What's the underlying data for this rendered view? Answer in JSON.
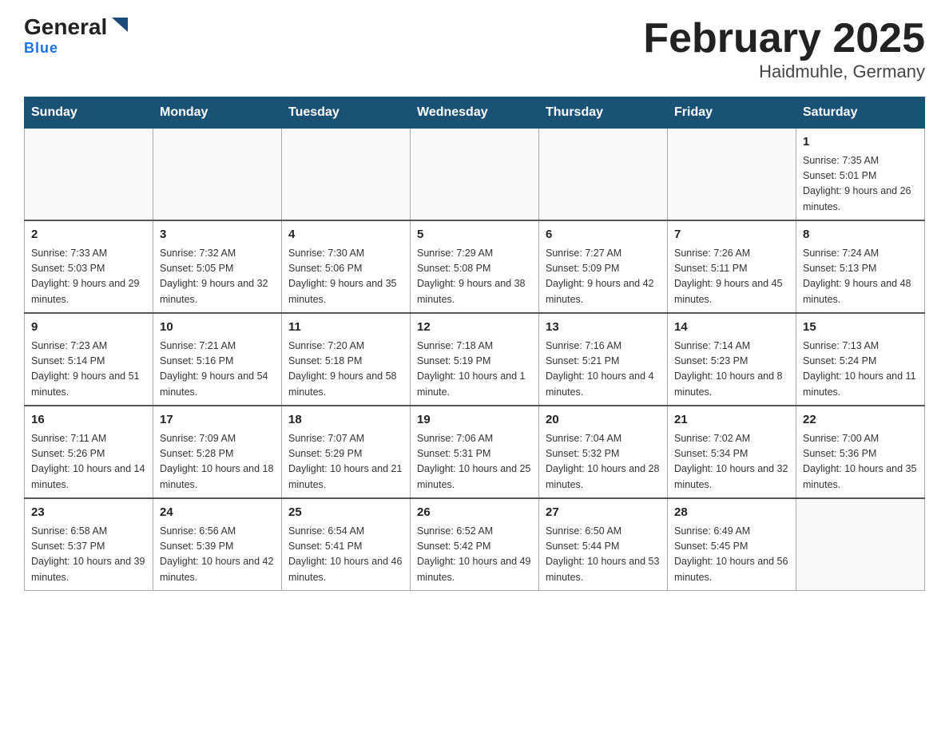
{
  "header": {
    "logo_main": "General",
    "logo_blue": "Blue",
    "title": "February 2025",
    "subtitle": "Haidmuhle, Germany"
  },
  "weekdays": [
    "Sunday",
    "Monday",
    "Tuesday",
    "Wednesday",
    "Thursday",
    "Friday",
    "Saturday"
  ],
  "weeks": [
    [
      {
        "day": "",
        "info": ""
      },
      {
        "day": "",
        "info": ""
      },
      {
        "day": "",
        "info": ""
      },
      {
        "day": "",
        "info": ""
      },
      {
        "day": "",
        "info": ""
      },
      {
        "day": "",
        "info": ""
      },
      {
        "day": "1",
        "info": "Sunrise: 7:35 AM\nSunset: 5:01 PM\nDaylight: 9 hours and 26 minutes."
      }
    ],
    [
      {
        "day": "2",
        "info": "Sunrise: 7:33 AM\nSunset: 5:03 PM\nDaylight: 9 hours and 29 minutes."
      },
      {
        "day": "3",
        "info": "Sunrise: 7:32 AM\nSunset: 5:05 PM\nDaylight: 9 hours and 32 minutes."
      },
      {
        "day": "4",
        "info": "Sunrise: 7:30 AM\nSunset: 5:06 PM\nDaylight: 9 hours and 35 minutes."
      },
      {
        "day": "5",
        "info": "Sunrise: 7:29 AM\nSunset: 5:08 PM\nDaylight: 9 hours and 38 minutes."
      },
      {
        "day": "6",
        "info": "Sunrise: 7:27 AM\nSunset: 5:09 PM\nDaylight: 9 hours and 42 minutes."
      },
      {
        "day": "7",
        "info": "Sunrise: 7:26 AM\nSunset: 5:11 PM\nDaylight: 9 hours and 45 minutes."
      },
      {
        "day": "8",
        "info": "Sunrise: 7:24 AM\nSunset: 5:13 PM\nDaylight: 9 hours and 48 minutes."
      }
    ],
    [
      {
        "day": "9",
        "info": "Sunrise: 7:23 AM\nSunset: 5:14 PM\nDaylight: 9 hours and 51 minutes."
      },
      {
        "day": "10",
        "info": "Sunrise: 7:21 AM\nSunset: 5:16 PM\nDaylight: 9 hours and 54 minutes."
      },
      {
        "day": "11",
        "info": "Sunrise: 7:20 AM\nSunset: 5:18 PM\nDaylight: 9 hours and 58 minutes."
      },
      {
        "day": "12",
        "info": "Sunrise: 7:18 AM\nSunset: 5:19 PM\nDaylight: 10 hours and 1 minute."
      },
      {
        "day": "13",
        "info": "Sunrise: 7:16 AM\nSunset: 5:21 PM\nDaylight: 10 hours and 4 minutes."
      },
      {
        "day": "14",
        "info": "Sunrise: 7:14 AM\nSunset: 5:23 PM\nDaylight: 10 hours and 8 minutes."
      },
      {
        "day": "15",
        "info": "Sunrise: 7:13 AM\nSunset: 5:24 PM\nDaylight: 10 hours and 11 minutes."
      }
    ],
    [
      {
        "day": "16",
        "info": "Sunrise: 7:11 AM\nSunset: 5:26 PM\nDaylight: 10 hours and 14 minutes."
      },
      {
        "day": "17",
        "info": "Sunrise: 7:09 AM\nSunset: 5:28 PM\nDaylight: 10 hours and 18 minutes."
      },
      {
        "day": "18",
        "info": "Sunrise: 7:07 AM\nSunset: 5:29 PM\nDaylight: 10 hours and 21 minutes."
      },
      {
        "day": "19",
        "info": "Sunrise: 7:06 AM\nSunset: 5:31 PM\nDaylight: 10 hours and 25 minutes."
      },
      {
        "day": "20",
        "info": "Sunrise: 7:04 AM\nSunset: 5:32 PM\nDaylight: 10 hours and 28 minutes."
      },
      {
        "day": "21",
        "info": "Sunrise: 7:02 AM\nSunset: 5:34 PM\nDaylight: 10 hours and 32 minutes."
      },
      {
        "day": "22",
        "info": "Sunrise: 7:00 AM\nSunset: 5:36 PM\nDaylight: 10 hours and 35 minutes."
      }
    ],
    [
      {
        "day": "23",
        "info": "Sunrise: 6:58 AM\nSunset: 5:37 PM\nDaylight: 10 hours and 39 minutes."
      },
      {
        "day": "24",
        "info": "Sunrise: 6:56 AM\nSunset: 5:39 PM\nDaylight: 10 hours and 42 minutes."
      },
      {
        "day": "25",
        "info": "Sunrise: 6:54 AM\nSunset: 5:41 PM\nDaylight: 10 hours and 46 minutes."
      },
      {
        "day": "26",
        "info": "Sunrise: 6:52 AM\nSunset: 5:42 PM\nDaylight: 10 hours and 49 minutes."
      },
      {
        "day": "27",
        "info": "Sunrise: 6:50 AM\nSunset: 5:44 PM\nDaylight: 10 hours and 53 minutes."
      },
      {
        "day": "28",
        "info": "Sunrise: 6:49 AM\nSunset: 5:45 PM\nDaylight: 10 hours and 56 minutes."
      },
      {
        "day": "",
        "info": ""
      }
    ]
  ]
}
